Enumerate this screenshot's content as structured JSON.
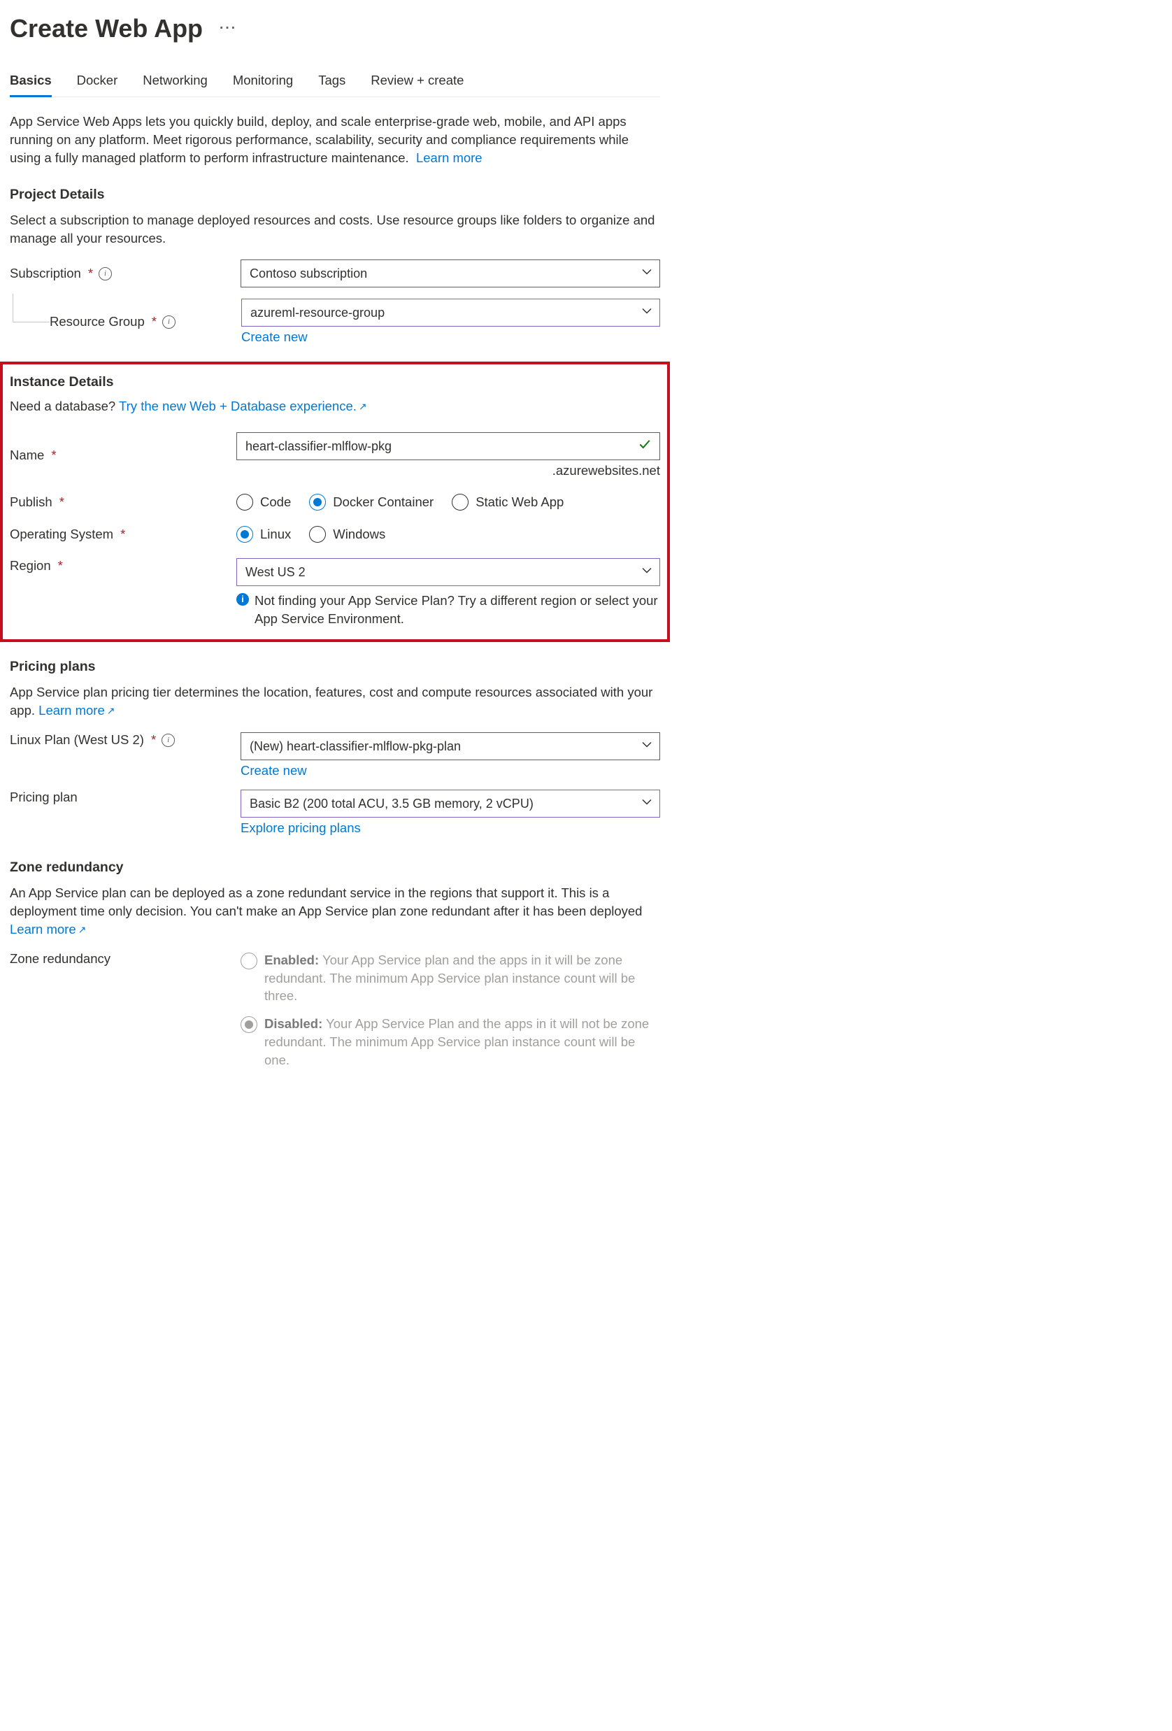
{
  "page": {
    "title": "Create Web App",
    "tabs": [
      "Basics",
      "Docker",
      "Networking",
      "Monitoring",
      "Tags",
      "Review + create"
    ],
    "intro": "App Service Web Apps lets you quickly build, deploy, and scale enterprise-grade web, mobile, and API apps running on any platform. Meet rigorous performance, scalability, security and compliance requirements while using a fully managed platform to perform infrastructure maintenance.",
    "learn_more": "Learn more"
  },
  "project": {
    "heading": "Project Details",
    "desc": "Select a subscription to manage deployed resources and costs. Use resource groups like folders to organize and manage all your resources.",
    "subscription_label": "Subscription",
    "subscription_value": "Contoso subscription",
    "rg_label": "Resource Group",
    "rg_value": "azureml-resource-group",
    "create_new": "Create new"
  },
  "instance": {
    "heading": "Instance Details",
    "db_prompt": "Need a database?",
    "db_link": "Try the new Web + Database experience.",
    "name_label": "Name",
    "name_value": "heart-classifier-mlflow-pkg",
    "domain_suffix": ".azurewebsites.net",
    "publish_label": "Publish",
    "publish_options": {
      "code": "Code",
      "docker": "Docker Container",
      "static": "Static Web App"
    },
    "os_label": "Operating System",
    "os_options": {
      "linux": "Linux",
      "windows": "Windows"
    },
    "region_label": "Region",
    "region_value": "West US 2",
    "region_note": "Not finding your App Service Plan? Try a different region or select your App Service Environment."
  },
  "pricing": {
    "heading": "Pricing plans",
    "desc": "App Service plan pricing tier determines the location, features, cost and compute resources associated with your app.",
    "learn_more": "Learn more",
    "plan_label": "Linux Plan (West US 2)",
    "plan_value": "(New) heart-classifier-mlflow-pkg-plan",
    "create_new": "Create new",
    "tier_label": "Pricing plan",
    "tier_value": "Basic B2 (200 total ACU, 3.5 GB memory, 2 vCPU)",
    "explore": "Explore pricing plans"
  },
  "zone": {
    "heading": "Zone redundancy",
    "desc": "An App Service plan can be deployed as a zone redundant service in the regions that support it. This is a deployment time only decision. You can't make an App Service plan zone redundant after it has been deployed",
    "learn_more": "Learn more",
    "label": "Zone redundancy",
    "enabled_title": "Enabled:",
    "enabled_desc": "Your App Service plan and the apps in it will be zone redundant. The minimum App Service plan instance count will be three.",
    "disabled_title": "Disabled:",
    "disabled_desc": "Your App Service Plan and the apps in it will not be zone redundant. The minimum App Service plan instance count will be one."
  }
}
